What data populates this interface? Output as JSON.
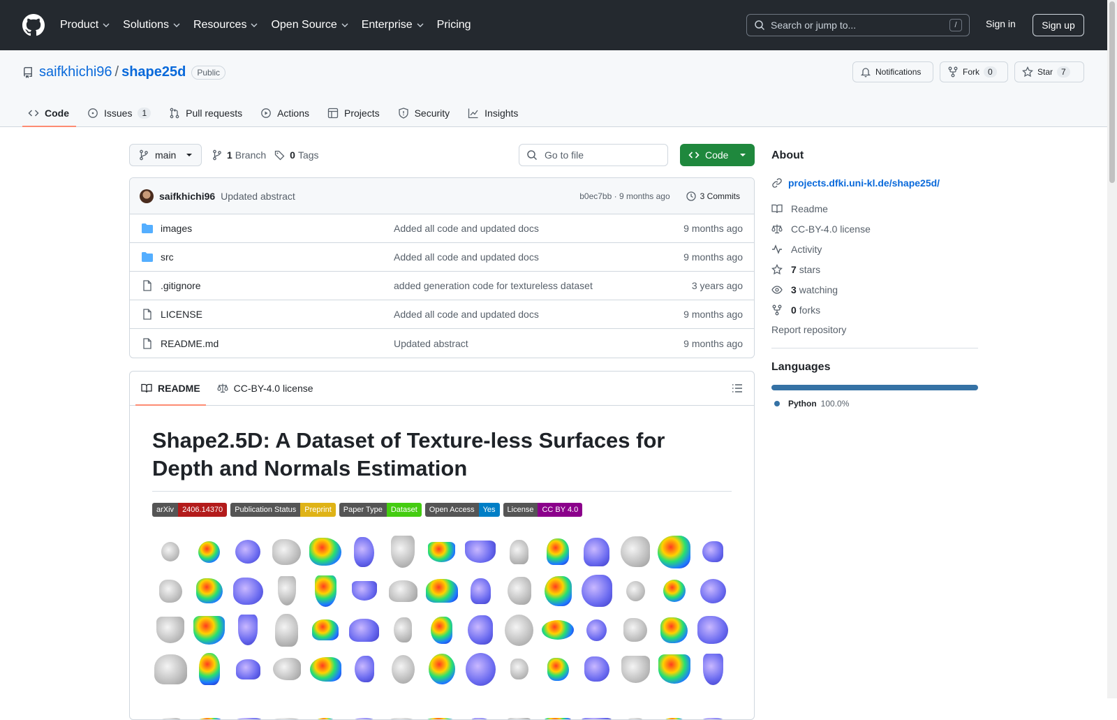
{
  "header": {
    "nav": [
      {
        "label": "Product",
        "dropdown": true
      },
      {
        "label": "Solutions",
        "dropdown": true
      },
      {
        "label": "Resources",
        "dropdown": true
      },
      {
        "label": "Open Source",
        "dropdown": true
      },
      {
        "label": "Enterprise",
        "dropdown": true
      },
      {
        "label": "Pricing",
        "dropdown": false
      }
    ],
    "search_placeholder": "Search or jump to...",
    "search_shortcut": "/",
    "signin": "Sign in",
    "signup": "Sign up"
  },
  "repo": {
    "owner": "saifkhichi96",
    "name": "shape25d",
    "visibility": "Public",
    "notifications_label": "Notifications",
    "fork_label": "Fork",
    "fork_count": "0",
    "star_label": "Star",
    "star_count": "7"
  },
  "tabs": [
    {
      "label": "Code",
      "icon": "code-icon",
      "active": true
    },
    {
      "label": "Issues",
      "icon": "issue-icon",
      "count": "1"
    },
    {
      "label": "Pull requests",
      "icon": "pull-request-icon"
    },
    {
      "label": "Actions",
      "icon": "play-icon"
    },
    {
      "label": "Projects",
      "icon": "table-icon"
    },
    {
      "label": "Security",
      "icon": "shield-icon"
    },
    {
      "label": "Insights",
      "icon": "graph-icon"
    }
  ],
  "branchbar": {
    "branch": "main",
    "branch_count": "1",
    "branch_word": "Branch",
    "tag_count": "0",
    "tag_word": "Tags",
    "goto_placeholder": "Go to file",
    "code_button": "Code"
  },
  "commit": {
    "author": "saifkhichi96",
    "message": "Updated abstract",
    "hash_time": "b0ec7bb · 9 months ago",
    "commits_label": "3 Commits"
  },
  "files": [
    {
      "name": "images",
      "type": "folder",
      "message": "Added all code and updated docs",
      "date": "9 months ago"
    },
    {
      "name": "src",
      "type": "folder",
      "message": "Added all code and updated docs",
      "date": "9 months ago"
    },
    {
      "name": ".gitignore",
      "type": "file",
      "message": "added generation code for textureless dataset",
      "date": "3 years ago"
    },
    {
      "name": "LICENSE",
      "type": "file",
      "message": "Added all code and updated docs",
      "date": "9 months ago"
    },
    {
      "name": "README.md",
      "type": "file",
      "message": "Updated abstract",
      "date": "9 months ago"
    }
  ],
  "readme": {
    "tab_readme": "README",
    "tab_license": "CC-BY-4.0 license",
    "title": "Shape2.5D: A Dataset of Texture-less Surfaces for Depth and Normals Estimation",
    "badges": [
      {
        "label": "arXiv",
        "value": "2406.14370",
        "color": "#b31b1b"
      },
      {
        "label": "Publication Status",
        "value": "Preprint",
        "color": "#dfb317"
      },
      {
        "label": "Paper Type",
        "value": "Dataset",
        "color": "#4c1"
      },
      {
        "label": "Open Access",
        "value": "Yes",
        "color": "#007ec6"
      },
      {
        "label": "License",
        "value": "CC BY 4.0",
        "color": "#8b008b"
      }
    ]
  },
  "about": {
    "heading": "About",
    "website": "projects.dfki.uni-kl.de/shape25d/",
    "readme_label": "Readme",
    "license_label": "CC-BY-4.0 license",
    "activity_label": "Activity",
    "stars_count": "7",
    "stars_label": "stars",
    "watching_count": "3",
    "watching_label": "watching",
    "forks_count": "0",
    "forks_label": "forks",
    "report_label": "Report repository"
  },
  "languages": {
    "heading": "Languages",
    "items": [
      {
        "name": "Python",
        "percent": "100.0%",
        "color": "#3572A5"
      }
    ]
  }
}
